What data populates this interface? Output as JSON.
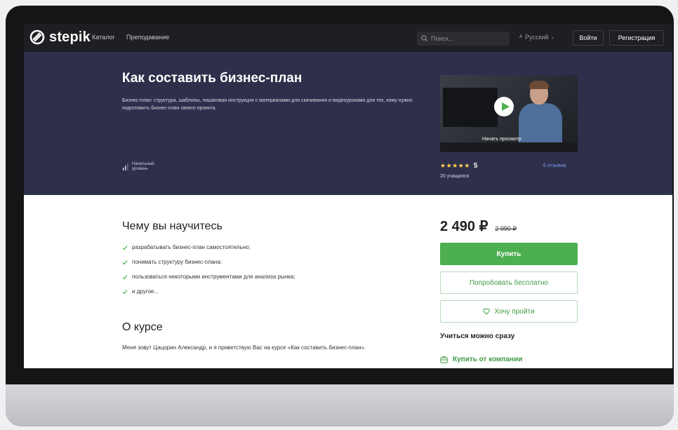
{
  "nav": {
    "logo_text": "stepik",
    "catalog_label": "Каталог",
    "teaching_label": "Преподавание",
    "search_placeholder": "Поиск...",
    "language_label": "Русский",
    "login_label": "Войти",
    "register_label": "Регистрация"
  },
  "course": {
    "title": "Как составить бизнес-план",
    "description": "Бизнес-план: структура, шаблоны, пошаговая инструкция с материалами для скачивания и видеоуроками для тех, кому нужно подготовить бизнес-план своего проекта.",
    "level_label": "Начальный уровень",
    "video_caption": "Начать просмотр",
    "stars": "★★★★★",
    "rating": "5",
    "reviews_link": "6 отзывов",
    "learners": "20 учащихся"
  },
  "learn": {
    "heading": "Чему вы научитесь",
    "items": [
      "разрабатывать бизнес-план самостоятельно;",
      "понимать структуру бизнес-плана;",
      "пользоваться некоторыми инструментами для анализа рынка;",
      "и другое..."
    ]
  },
  "about": {
    "heading": "О курсе",
    "text": "Меня зовут Цацорин Александр, и я приветствую Вас на курсе «Как составить бизнес-план»."
  },
  "purchase": {
    "price": "2 490 ₽",
    "old_price": "2 990 ₽",
    "buy_label": "Купить",
    "trial_label": "Попробовать бесплатно",
    "wishlist_label": "Хочу пройти",
    "start_note": "Учиться можно сразу",
    "company_label": "Купить от компании"
  },
  "colors": {
    "hero_bg": "#2e2f4a",
    "accent_green": "#4caf50",
    "nav_bg": "#1e1f22",
    "star": "#ffd24c"
  },
  "icons": [
    "stepik-logo-icon",
    "search-icon",
    "translate-icon",
    "level-bars-icon",
    "play-icon",
    "checkmark-icon",
    "heart-icon",
    "briefcase-icon"
  ]
}
